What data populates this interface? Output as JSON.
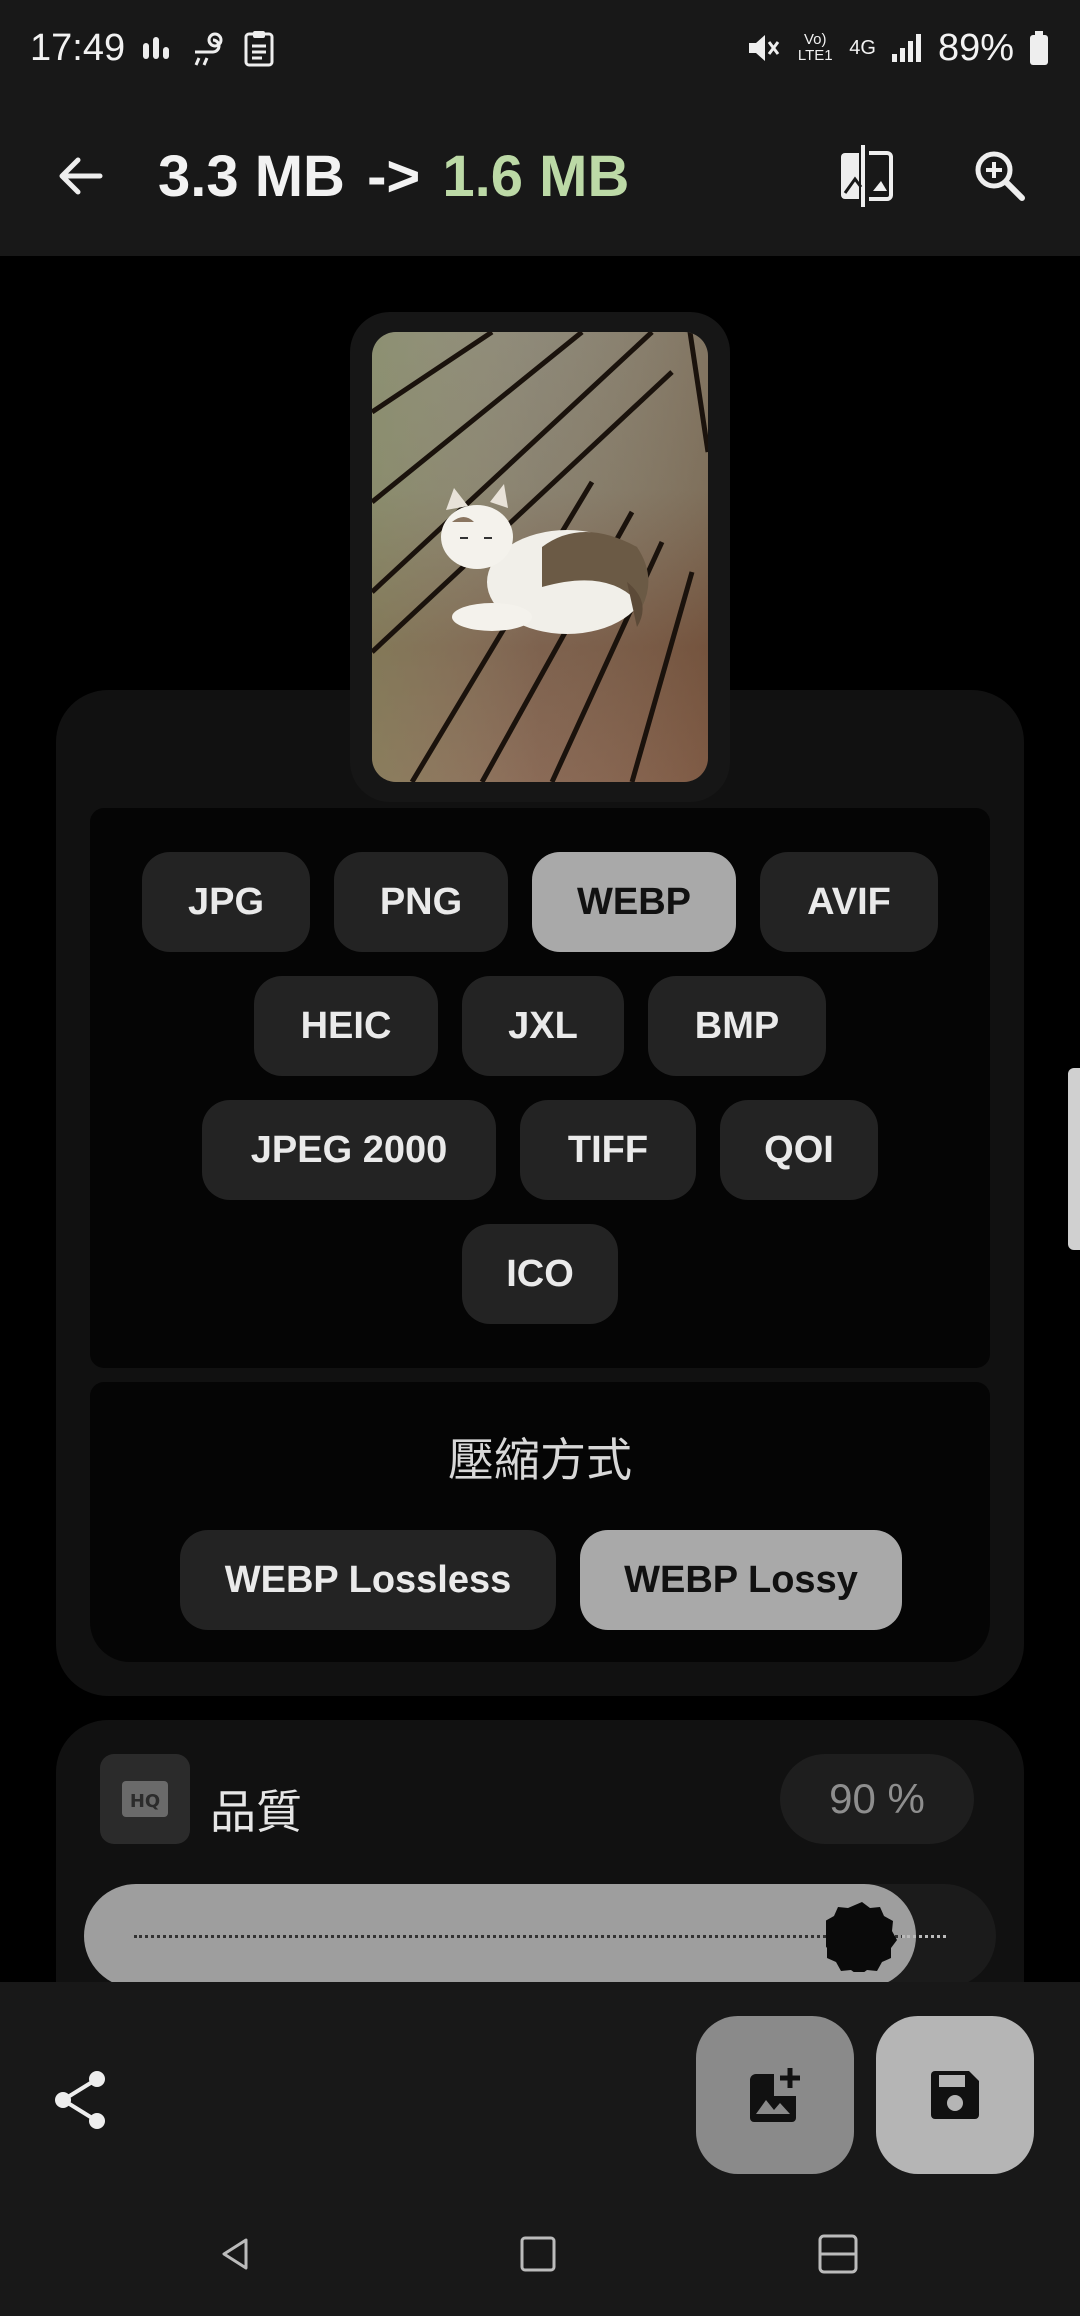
{
  "status": {
    "time": "17:49",
    "network_label": "Vo) LTE1",
    "network_type": "4G",
    "battery": "89%"
  },
  "appbar": {
    "original_size": "3.3 MB",
    "arrow": "->",
    "new_size": "1.6 MB"
  },
  "formats": {
    "items": [
      "JPG",
      "PNG",
      "WEBP",
      "AVIF",
      "HEIC",
      "JXL",
      "BMP",
      "JPEG 2000",
      "TIFF",
      "QOI",
      "ICO"
    ],
    "selected": "WEBP"
  },
  "compression": {
    "title": "壓縮方式",
    "options": [
      "WEBP Lossless",
      "WEBP Lossy"
    ],
    "selected": "WEBP Lossy"
  },
  "quality": {
    "badge": "HQ",
    "label": "品質",
    "value_text": "90 %",
    "value": 90
  },
  "colors": {
    "accent_green": "#bcd9a6",
    "selected_chip": "#a9a9a9",
    "chip": "#232323"
  },
  "icons": [
    "back-arrow-icon",
    "compare-icon",
    "zoom-in-icon",
    "share-icon",
    "add-image-icon",
    "save-icon"
  ]
}
